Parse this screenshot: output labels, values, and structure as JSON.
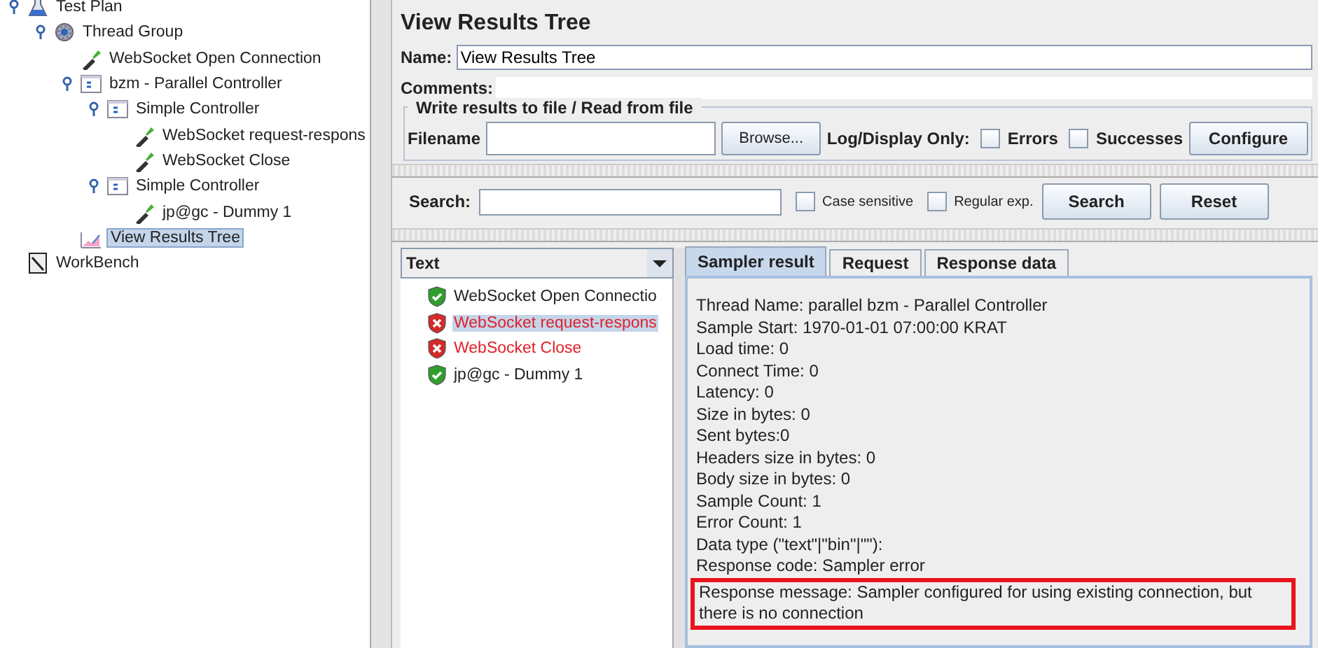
{
  "tree": [
    {
      "label": "Test Plan",
      "kind": "plan",
      "selected": false,
      "children": [
        {
          "label": "Thread Group",
          "kind": "threads",
          "selected": false,
          "children": [
            {
              "label": "WebSocket Open Connection",
              "kind": "sampler",
              "selected": false
            },
            {
              "label": "bzm - Parallel Controller",
              "kind": "controller",
              "selected": false,
              "children": [
                {
                  "label": "Simple Controller",
                  "kind": "controller",
                  "selected": false,
                  "children": [
                    {
                      "label": "WebSocket request-respons",
                      "kind": "sampler",
                      "selected": false
                    },
                    {
                      "label": "WebSocket Close",
                      "kind": "sampler",
                      "selected": false
                    }
                  ]
                },
                {
                  "label": "Simple Controller",
                  "kind": "controller",
                  "selected": false,
                  "children": [
                    {
                      "label": "jp@gc - Dummy 1",
                      "kind": "sampler",
                      "selected": false
                    }
                  ]
                }
              ]
            },
            {
              "label": "View Results Tree",
              "kind": "listener",
              "selected": true
            }
          ]
        }
      ]
    },
    {
      "label": "WorkBench",
      "kind": "workbench",
      "selected": false
    }
  ],
  "panel": {
    "title": "View Results Tree",
    "name_label": "Name:",
    "name_value": "View Results Tree",
    "comments_label": "Comments:"
  },
  "file_group": {
    "legend": "Write results to file / Read from file",
    "filename_label": "Filename",
    "browse": "Browse...",
    "log_label": "Log/Display Only:",
    "options": [
      {
        "label": "Errors",
        "checked": false
      },
      {
        "label": "Successes",
        "checked": false
      }
    ],
    "configure": "Configure"
  },
  "search": {
    "label": "Search:",
    "options": [
      {
        "label": "Case sensitive",
        "checked": false
      },
      {
        "label": "Regular exp.",
        "checked": false
      }
    ],
    "buttons": [
      "Search",
      "Reset"
    ]
  },
  "results": {
    "renderer": "Text",
    "items": [
      {
        "label": "WebSocket Open Connectio",
        "ok": true,
        "selected": false
      },
      {
        "label": "WebSocket request-respons",
        "ok": false,
        "selected": true
      },
      {
        "label": "WebSocket Close",
        "ok": false,
        "selected": false
      },
      {
        "label": "jp@gc - Dummy 1",
        "ok": true,
        "selected": false
      }
    ]
  },
  "tabs": [
    {
      "label": "Sampler result",
      "selected": true
    },
    {
      "label": "Request",
      "selected": false
    },
    {
      "label": "Response data",
      "selected": false
    }
  ],
  "details": [
    {
      "text": "Thread Name: parallel bzm - Parallel Controller",
      "highlighted": false
    },
    {
      "text": "Sample Start: 1970-01-01 07:00:00 KRAT",
      "highlighted": false
    },
    {
      "text": "Load time: 0",
      "highlighted": false
    },
    {
      "text": "Connect Time: 0",
      "highlighted": false
    },
    {
      "text": "Latency: 0",
      "highlighted": false
    },
    {
      "text": "Size in bytes: 0",
      "highlighted": false
    },
    {
      "text": "Sent bytes:0",
      "highlighted": false
    },
    {
      "text": "Headers size in bytes: 0",
      "highlighted": false
    },
    {
      "text": "Body size in bytes: 0",
      "highlighted": false
    },
    {
      "text": "Sample Count: 1",
      "highlighted": false
    },
    {
      "text": "Error Count: 1",
      "highlighted": false
    },
    {
      "text": "Data type (\"text\"|\"bin\"|\"\"):",
      "highlighted": false
    },
    {
      "text": "Response code: Sampler error",
      "highlighted": false
    },
    {
      "text": "Response message: Sampler configured for using existing connection, but there is no connection",
      "highlighted": true
    }
  ]
}
